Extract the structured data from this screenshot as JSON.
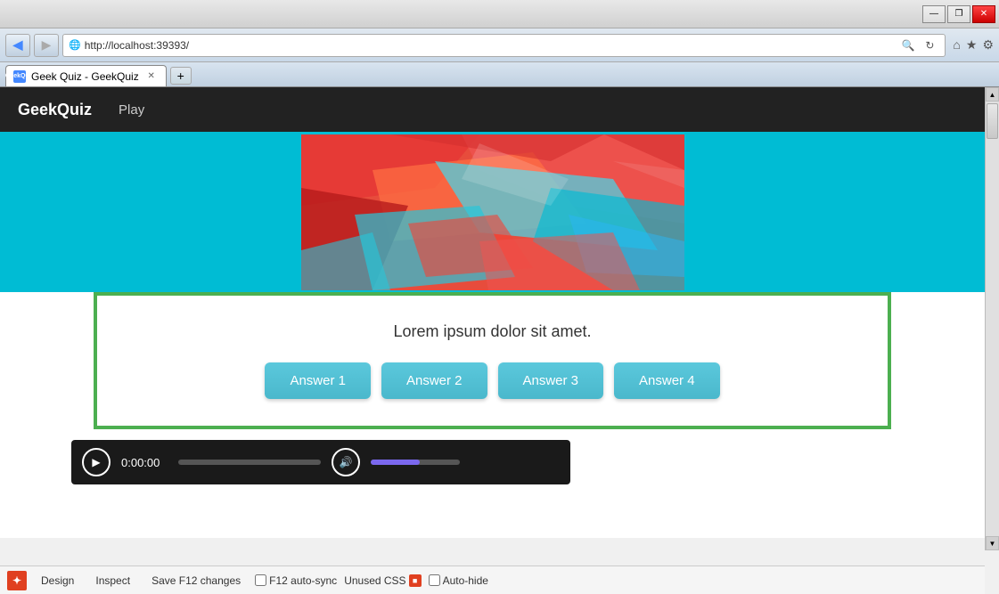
{
  "browser": {
    "title_buttons": {
      "minimize": "—",
      "restore": "❐",
      "close": "✕"
    },
    "address": "http://localhost:39393/",
    "tab": {
      "favicon": "G",
      "label": "Geek Quiz - GeekQuiz",
      "close": "✕"
    },
    "nav": {
      "back": "◀",
      "forward": "▶",
      "refresh": "↻",
      "search_icon": "🔍"
    },
    "right_icons": [
      "⌂",
      "★",
      "⚙"
    ]
  },
  "app": {
    "brand": "GeekQuiz",
    "nav_links": [
      "Play"
    ]
  },
  "quiz": {
    "question": "Lorem ipsum dolor sit amet.",
    "answers": [
      "Answer 1",
      "Answer 2",
      "Answer 3",
      "Answer 4"
    ]
  },
  "media_player": {
    "time": "0:00:00",
    "play_icon": "▶"
  },
  "devtools": {
    "logo": "✦",
    "buttons": [
      "Design",
      "Inspect",
      "Save F12 changes"
    ],
    "f12_autosync_label": "F12 auto-sync",
    "unused_css_label": "Unused CSS",
    "autohide_label": "Auto-hide"
  },
  "scrollbar": {
    "up": "▲",
    "down": "▼"
  }
}
